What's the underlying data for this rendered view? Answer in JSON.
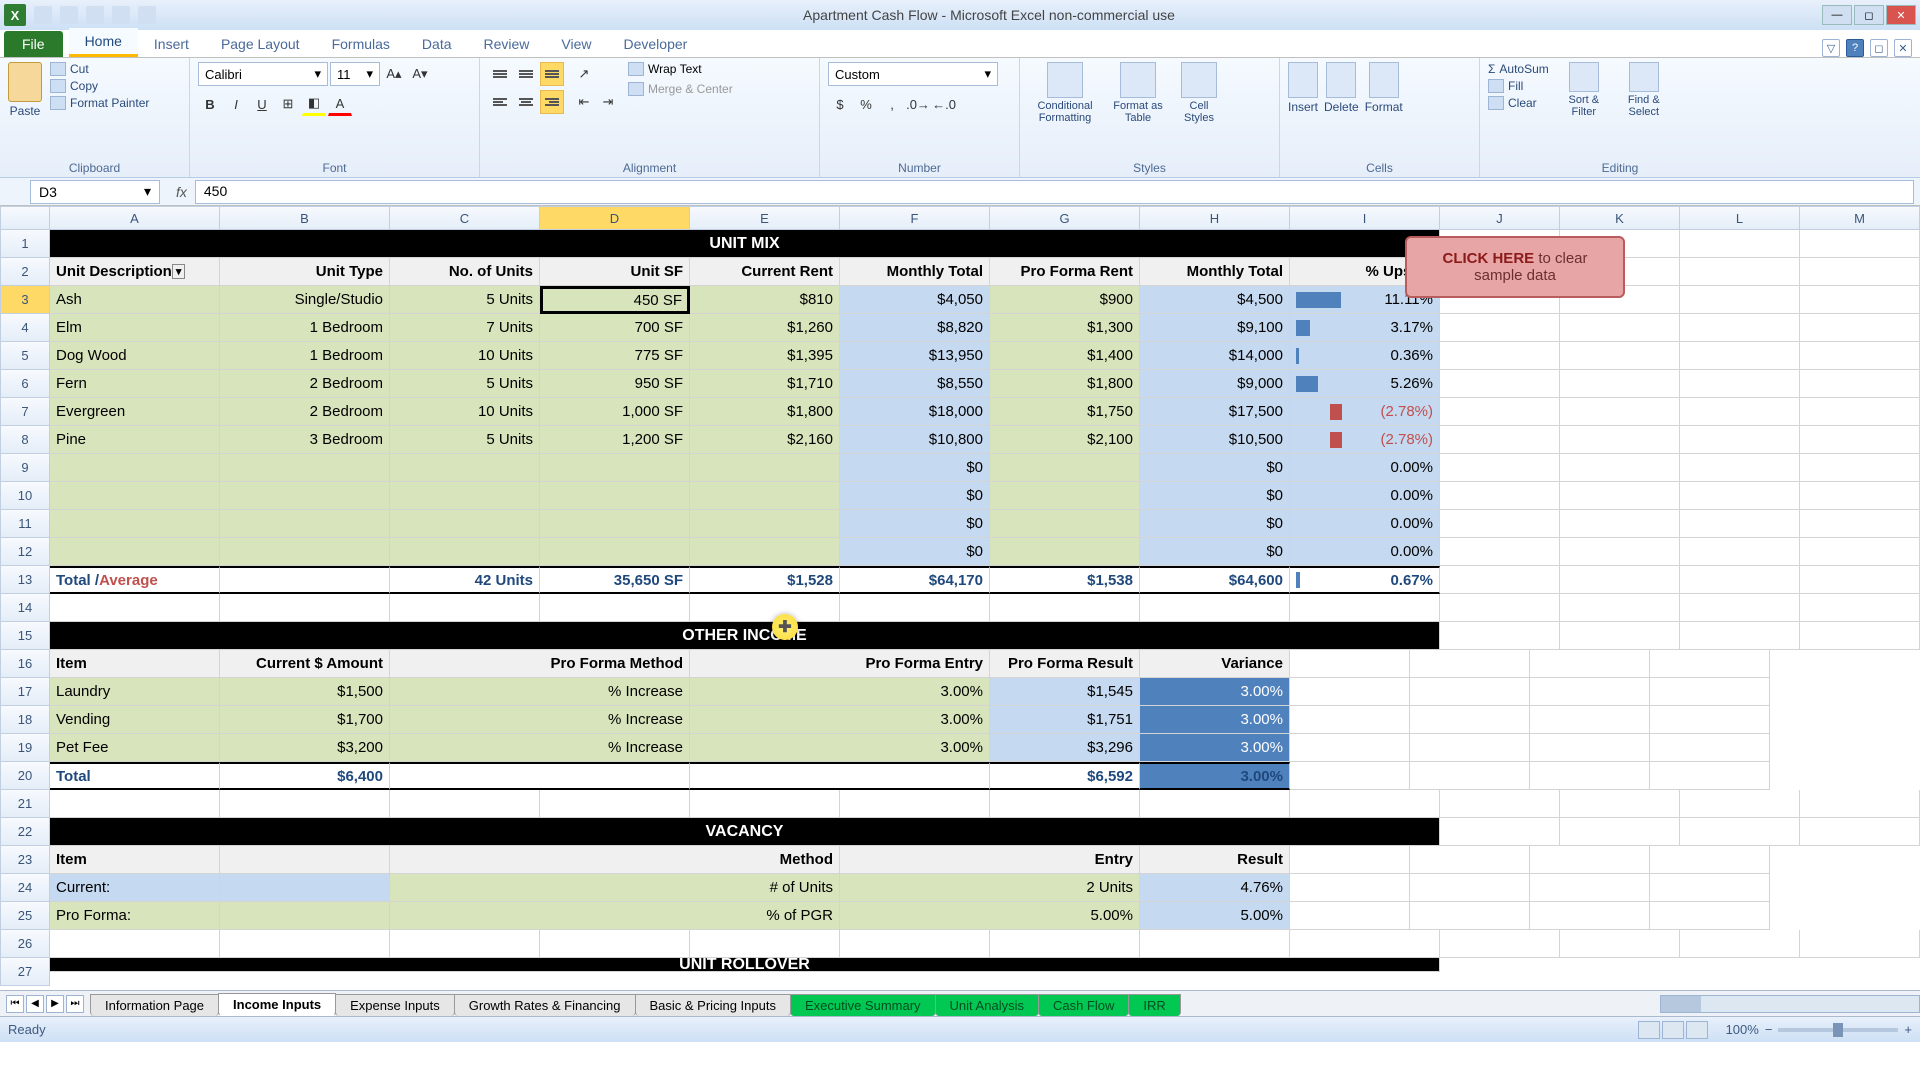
{
  "title": "Apartment Cash Flow - Microsoft Excel non-commercial use",
  "ribbon": {
    "file": "File",
    "tabs": [
      "Home",
      "Insert",
      "Page Layout",
      "Formulas",
      "Data",
      "Review",
      "View",
      "Developer"
    ],
    "active_tab": "Home",
    "clipboard": {
      "paste": "Paste",
      "cut": "Cut",
      "copy": "Copy",
      "fmt": "Format Painter",
      "label": "Clipboard"
    },
    "font": {
      "name": "Calibri",
      "size": "11",
      "label": "Font"
    },
    "alignment": {
      "wrap": "Wrap Text",
      "merge": "Merge & Center",
      "label": "Alignment"
    },
    "number": {
      "format": "Custom",
      "label": "Number"
    },
    "styles": {
      "cond": "Conditional Formatting",
      "table": "Format as Table",
      "cell": "Cell Styles",
      "label": "Styles"
    },
    "cells": {
      "insert": "Insert",
      "delete": "Delete",
      "format": "Format",
      "label": "Cells"
    },
    "editing": {
      "sum": "AutoSum",
      "fill": "Fill",
      "clear": "Clear",
      "sort": "Sort & Filter",
      "find": "Find & Select",
      "label": "Editing"
    }
  },
  "namebox": "D3",
  "formula": "450",
  "columns": [
    "A",
    "B",
    "C",
    "D",
    "E",
    "F",
    "G",
    "H",
    "I",
    "J",
    "K",
    "L",
    "M"
  ],
  "selected_col": "D",
  "row_numbers": [
    1,
    2,
    3,
    4,
    5,
    6,
    7,
    8,
    9,
    10,
    11,
    12,
    13,
    14,
    15,
    16,
    17,
    18,
    19,
    20,
    21,
    22,
    23,
    24,
    25,
    26,
    27
  ],
  "selected_row": 3,
  "unitmix": {
    "title": "UNIT MIX",
    "headers": {
      "desc": "Unit Description",
      "type": "Unit Type",
      "num": "No. of Units",
      "sf": "Unit SF",
      "rent": "Current Rent",
      "mtot": "Monthly Total",
      "pf": "Pro Forma Rent",
      "mtot2": "Monthly Total",
      "up": "% Upside"
    },
    "rows": [
      {
        "a": "Ash",
        "b": "Single/Studio",
        "c": "5 Units",
        "d": "450 SF",
        "e": "$810",
        "f": "$4,050",
        "g": "$900",
        "h": "$4,500",
        "i": "11.11%",
        "bar": 45,
        "dir": "pos"
      },
      {
        "a": "Elm",
        "b": "1 Bedroom",
        "c": "7 Units",
        "d": "700 SF",
        "e": "$1,260",
        "f": "$8,820",
        "g": "$1,300",
        "h": "$9,100",
        "i": "3.17%",
        "bar": 14,
        "dir": "pos"
      },
      {
        "a": "Dog Wood",
        "b": "1 Bedroom",
        "c": "10 Units",
        "d": "775 SF",
        "e": "$1,395",
        "f": "$13,950",
        "g": "$1,400",
        "h": "$14,000",
        "i": "0.36%",
        "bar": 3,
        "dir": "pos"
      },
      {
        "a": "Fern",
        "b": "2 Bedroom",
        "c": "5 Units",
        "d": "950 SF",
        "e": "$1,710",
        "f": "$8,550",
        "g": "$1,800",
        "h": "$9,000",
        "i": "5.26%",
        "bar": 22,
        "dir": "pos"
      },
      {
        "a": "Evergreen",
        "b": "2 Bedroom",
        "c": "10 Units",
        "d": "1,000 SF",
        "e": "$1,800",
        "f": "$18,000",
        "g": "$1,750",
        "h": "$17,500",
        "i": "(2.78%)",
        "bar": 12,
        "dir": "neg"
      },
      {
        "a": "Pine",
        "b": "3 Bedroom",
        "c": "5 Units",
        "d": "1,200 SF",
        "e": "$2,160",
        "f": "$10,800",
        "g": "$2,100",
        "h": "$10,500",
        "i": "(2.78%)",
        "bar": 12,
        "dir": "neg"
      }
    ],
    "empty": [
      {
        "f": "$0",
        "h": "$0",
        "i": "0.00%"
      },
      {
        "f": "$0",
        "h": "$0",
        "i": "0.00%"
      },
      {
        "f": "$0",
        "h": "$0",
        "i": "0.00%"
      },
      {
        "f": "$0",
        "h": "$0",
        "i": "0.00%"
      }
    ],
    "total": {
      "label": "Total / ",
      "avg": "Average",
      "c": "42 Units",
      "d": "35,650 SF",
      "e": "$1,528",
      "f": "$64,170",
      "g": "$1,538",
      "h": "$64,600",
      "i": "0.67%",
      "bar": 4
    }
  },
  "other": {
    "title": "OTHER INCOME",
    "headers": {
      "item": "Item",
      "amt": "Current $ Amount",
      "method": "Pro Forma Method",
      "entry": "Pro Forma Entry",
      "result": "Pro Forma Result",
      "var": "Variance"
    },
    "rows": [
      {
        "a": "Laundry",
        "b": "$1,500",
        "c": "% Increase",
        "f": "3.00%",
        "h": "$1,545",
        "i": "3.00%"
      },
      {
        "a": "Vending",
        "b": "$1,700",
        "c": "% Increase",
        "f": "3.00%",
        "h": "$1,751",
        "i": "3.00%"
      },
      {
        "a": "Pet Fee",
        "b": "$3,200",
        "c": "% Increase",
        "f": "3.00%",
        "h": "$3,296",
        "i": "3.00%"
      }
    ],
    "total": {
      "a": "Total",
      "b": "$6,400",
      "h": "$6,592",
      "i": "3.00%"
    }
  },
  "vacancy": {
    "title": "VACANCY",
    "headers": {
      "item": "Item",
      "method": "Method",
      "entry": "Entry",
      "result": "Result"
    },
    "rows": [
      {
        "a": "Current:",
        "e": "# of Units",
        "g": "2 Units",
        "i": "4.76%"
      },
      {
        "a": "Pro Forma:",
        "e": "% of PGR",
        "g": "5.00%",
        "i": "5.00%"
      }
    ]
  },
  "rollover": {
    "title": "UNIT ROLLOVER"
  },
  "clear_btn": {
    "bold": "CLICK HERE",
    "rest": " to clear sample data"
  },
  "sheets": {
    "tabs": [
      "Information Page",
      "Income Inputs",
      "Expense Inputs",
      "Growth Rates & Financing",
      "Basic & Pricing Inputs",
      "Executive Summary",
      "Unit Analysis",
      "Cash Flow",
      "IRR"
    ],
    "active": "Income Inputs",
    "green": [
      "Executive Summary",
      "Unit Analysis",
      "Cash Flow",
      "IRR"
    ]
  },
  "status": {
    "ready": "Ready",
    "zoom": "100%"
  }
}
